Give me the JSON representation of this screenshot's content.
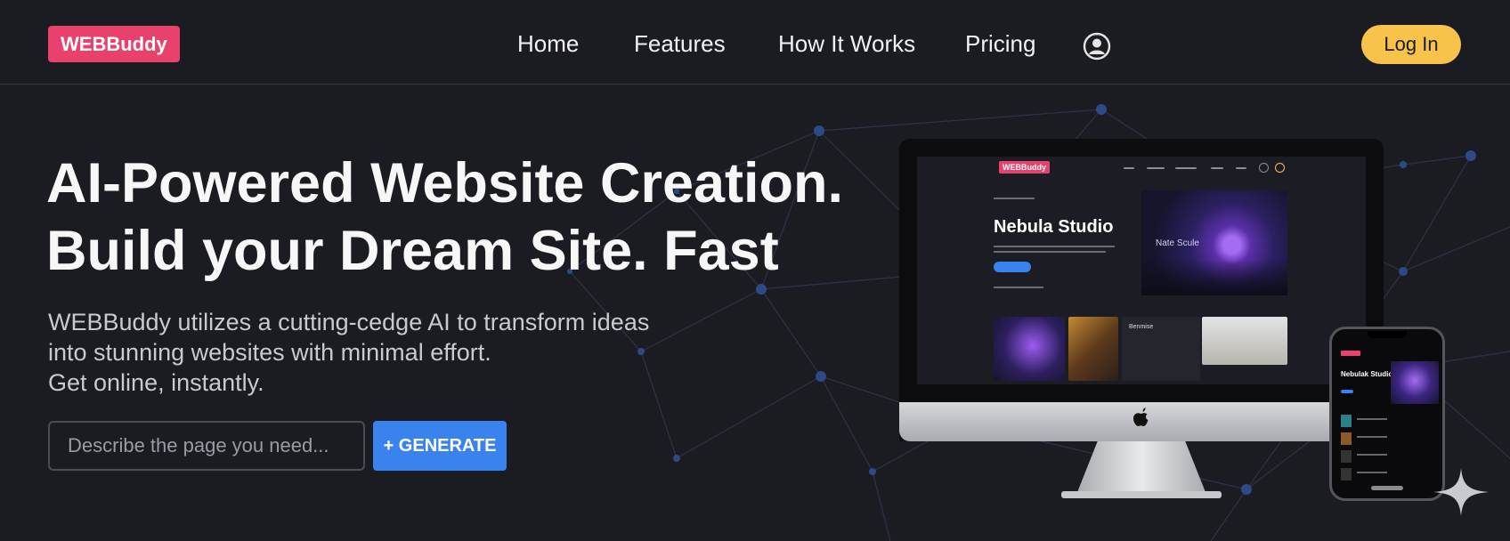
{
  "brand": {
    "logo_text": "WEBBuddy",
    "accent": "#e8416c"
  },
  "nav": {
    "items": [
      {
        "label": "Home"
      },
      {
        "label": "Features"
      },
      {
        "label": "How It Works"
      },
      {
        "label": "Pricing"
      }
    ],
    "account_icon": "user-circle-icon",
    "login_label": "Log In",
    "login_color": "#f7c34a"
  },
  "hero": {
    "title_lines": [
      "AI-Powered Website Creation.",
      "Build your Dream Site. Fast"
    ],
    "subtitle_lines": [
      "WEBBuddy utilizes a cutting-cedge AI to transform ideas",
      "into stunning websites with minimal effort.",
      "Get online, instantly."
    ],
    "input_placeholder": "Describe the page you need...",
    "generate_label": "+ GENERATE",
    "generate_color": "#3a82ee"
  },
  "mockup": {
    "desktop_logo": "WEBBuddy",
    "desktop_title": "Nebula Studio",
    "desktop_image_caption": "Nate Scule",
    "desktop_card_title": "Benmise",
    "phone_title": "Nebulak Studio"
  },
  "colors": {
    "background": "#1b1c22",
    "network_line": "#2d3248",
    "network_node": "#2c4a86"
  }
}
